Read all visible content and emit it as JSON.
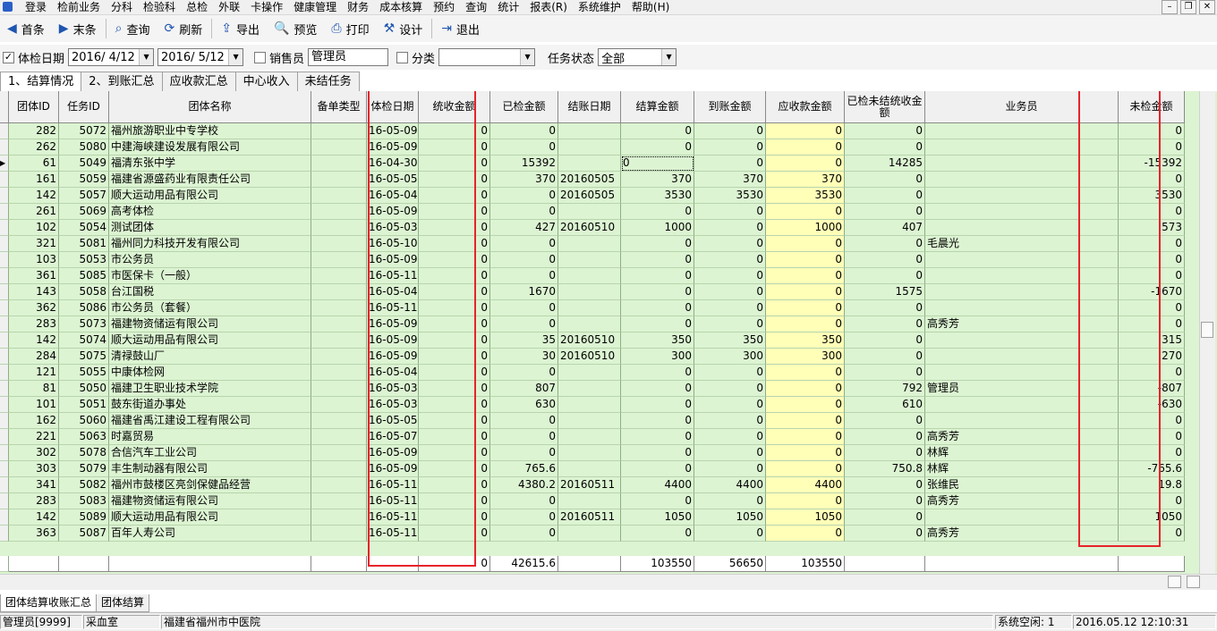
{
  "menu": [
    "登录",
    "检前业务",
    "分科",
    "检验科",
    "总检",
    "外联",
    "卡操作",
    "健康管理",
    "财务",
    "成本核算",
    "预约",
    "查询",
    "统计",
    "报表(R)",
    "系统维护",
    "帮助(H)"
  ],
  "toolbar": {
    "first": "首条",
    "last": "末条",
    "query": "查询",
    "refresh": "刷新",
    "export": "导出",
    "preview": "预览",
    "print": "打印",
    "design": "设计",
    "exit": "退出"
  },
  "filter": {
    "exam_date_label": "体检日期",
    "date_from": "2016/ 4/12",
    "date_to": "2016/ 5/12",
    "sales_label": "销售员",
    "sales_value": "管理员",
    "category_label": "分类",
    "category_value": "",
    "status_label": "任务状态",
    "status_value": "全部"
  },
  "tabs": [
    "1、结算情况",
    "2、到账汇总",
    "应收款汇总",
    "中心收入",
    "未结任务"
  ],
  "columns": [
    "团体ID",
    "任务ID",
    "团体名称",
    "备单类型",
    "体检日期",
    "统收金额",
    "已检金额",
    "结账日期",
    "结算金额",
    "到账金额",
    "应收款金额",
    "已检未结统收金额",
    "业务员",
    "未检金额"
  ],
  "rows": [
    [
      "282",
      "5072",
      "福州旅游职业中专学校",
      "",
      "16-05-09",
      "0",
      "0",
      "",
      "0",
      "0",
      "0",
      "0",
      "",
      "0"
    ],
    [
      "262",
      "5080",
      "中建海峡建设发展有限公司",
      "",
      "16-05-09",
      "0",
      "0",
      "",
      "0",
      "0",
      "0",
      "0",
      "",
      "0"
    ],
    [
      "61",
      "5049",
      "福清东张中学",
      "",
      "16-04-30",
      "0",
      "15392",
      "",
      "0",
      "0",
      "0",
      "14285",
      "",
      "-15392"
    ],
    [
      "161",
      "5059",
      "福建省源盛药业有限责任公司",
      "",
      "16-05-05",
      "0",
      "370",
      "20160505",
      "370",
      "370",
      "370",
      "0",
      "",
      "0"
    ],
    [
      "142",
      "5057",
      "顺大运动用品有限公司",
      "",
      "16-05-04",
      "0",
      "0",
      "20160505",
      "3530",
      "3530",
      "3530",
      "0",
      "",
      "3530"
    ],
    [
      "261",
      "5069",
      "高考体检",
      "",
      "16-05-09",
      "0",
      "0",
      "",
      "0",
      "0",
      "0",
      "0",
      "",
      "0"
    ],
    [
      "102",
      "5054",
      "测试团体",
      "",
      "16-05-03",
      "0",
      "427",
      "20160510",
      "1000",
      "0",
      "1000",
      "407",
      "",
      "573"
    ],
    [
      "321",
      "5081",
      "福州同力科技开发有限公司",
      "",
      "16-05-10",
      "0",
      "0",
      "",
      "0",
      "0",
      "0",
      "0",
      "毛晨光",
      "0"
    ],
    [
      "103",
      "5053",
      "市公务员",
      "",
      "16-05-09",
      "0",
      "0",
      "",
      "0",
      "0",
      "0",
      "0",
      "",
      "0"
    ],
    [
      "361",
      "5085",
      "市医保卡（一般）",
      "",
      "16-05-11",
      "0",
      "0",
      "",
      "0",
      "0",
      "0",
      "0",
      "",
      "0"
    ],
    [
      "143",
      "5058",
      "台江国税",
      "",
      "16-05-04",
      "0",
      "1670",
      "",
      "0",
      "0",
      "0",
      "1575",
      "",
      "-1670"
    ],
    [
      "362",
      "5086",
      "市公务员（套餐）",
      "",
      "16-05-11",
      "0",
      "0",
      "",
      "0",
      "0",
      "0",
      "0",
      "",
      "0"
    ],
    [
      "283",
      "5073",
      "福建物资储运有限公司",
      "",
      "16-05-09",
      "0",
      "0",
      "",
      "0",
      "0",
      "0",
      "0",
      "高秀芳",
      "0"
    ],
    [
      "142",
      "5074",
      "顺大运动用品有限公司",
      "",
      "16-05-09",
      "0",
      "35",
      "20160510",
      "350",
      "350",
      "350",
      "0",
      "",
      "315"
    ],
    [
      "284",
      "5075",
      "清禄鼓山厂",
      "",
      "16-05-09",
      "0",
      "30",
      "20160510",
      "300",
      "300",
      "300",
      "0",
      "",
      "270"
    ],
    [
      "121",
      "5055",
      "中康体检网",
      "",
      "16-05-04",
      "0",
      "0",
      "",
      "0",
      "0",
      "0",
      "0",
      "",
      "0"
    ],
    [
      "81",
      "5050",
      "福建卫生职业技术学院",
      "",
      "16-05-03",
      "0",
      "807",
      "",
      "0",
      "0",
      "0",
      "792",
      "管理员",
      "-807"
    ],
    [
      "101",
      "5051",
      "鼓东街道办事处",
      "",
      "16-05-03",
      "0",
      "630",
      "",
      "0",
      "0",
      "0",
      "610",
      "",
      "-630"
    ],
    [
      "162",
      "5060",
      "福建省禹江建设工程有限公司",
      "",
      "16-05-05",
      "0",
      "0",
      "",
      "0",
      "0",
      "0",
      "0",
      "",
      "0"
    ],
    [
      "221",
      "5063",
      "时嘉贸易",
      "",
      "16-05-07",
      "0",
      "0",
      "",
      "0",
      "0",
      "0",
      "0",
      "高秀芳",
      "0"
    ],
    [
      "302",
      "5078",
      "合信汽车工业公司",
      "",
      "16-05-09",
      "0",
      "0",
      "",
      "0",
      "0",
      "0",
      "0",
      "林辉",
      "0"
    ],
    [
      "303",
      "5079",
      "丰生制动器有限公司",
      "",
      "16-05-09",
      "0",
      "765.6",
      "",
      "0",
      "0",
      "0",
      "750.8",
      "林辉",
      "-765.6"
    ],
    [
      "341",
      "5082",
      "福州市鼓楼区亮剑保健品经营",
      "",
      "16-05-11",
      "0",
      "4380.2",
      "20160511",
      "4400",
      "4400",
      "4400",
      "0",
      "张维民",
      "19.8"
    ],
    [
      "283",
      "5083",
      "福建物资储运有限公司",
      "",
      "16-05-11",
      "0",
      "0",
      "",
      "0",
      "0",
      "0",
      "0",
      "高秀芳",
      "0"
    ],
    [
      "142",
      "5089",
      "顺大运动用品有限公司",
      "",
      "16-05-11",
      "0",
      "0",
      "20160511",
      "1050",
      "1050",
      "1050",
      "0",
      "",
      "1050"
    ],
    [
      "363",
      "5087",
      "百年人寿公司",
      "",
      "16-05-11",
      "0",
      "0",
      "",
      "0",
      "0",
      "0",
      "0",
      "高秀芳",
      "0"
    ]
  ],
  "totals": [
    "",
    "",
    "",
    "",
    "",
    "0",
    "42615.6",
    "",
    "103550",
    "56650",
    "103550",
    "",
    "",
    ""
  ],
  "selected_cell": {
    "row": 2,
    "col": 8
  },
  "bottom_tabs": [
    "团体结算收账汇总",
    "团体结算"
  ],
  "status": {
    "user": "管理员[9999]",
    "dept": "采血室",
    "hospital": "福建省福州市中医院",
    "idle": "系统空闲: 1",
    "datetime": "2016.05.12 12:10:31"
  },
  "colors": {
    "grid_bg": "#dcf4d2",
    "receivable_bg": "#ffffb8",
    "highlight_border": "#e8232a"
  }
}
